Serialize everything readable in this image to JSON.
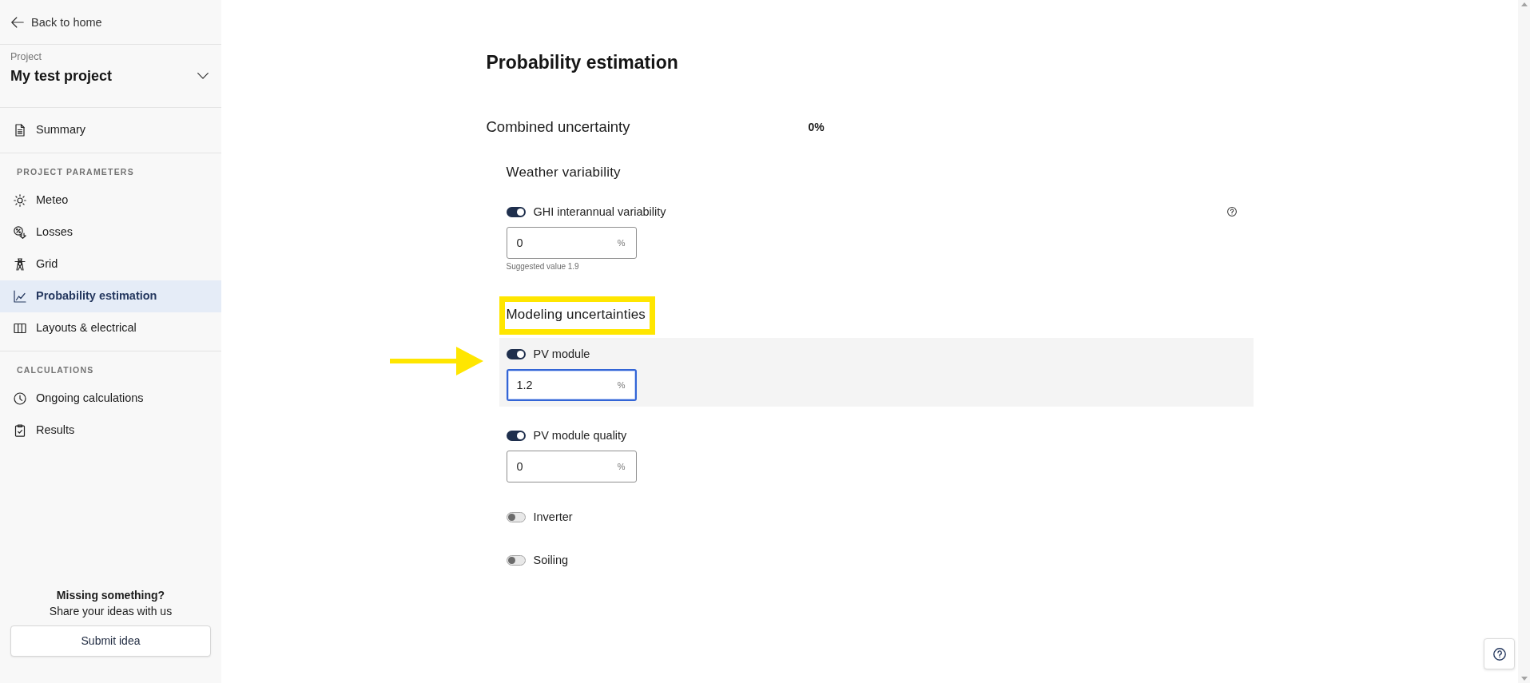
{
  "sidebar": {
    "back_link": "Back to home",
    "project": {
      "label": "Project",
      "name": "My test project"
    },
    "sections": [
      {
        "items": [
          {
            "label": "Summary",
            "selected": false
          }
        ]
      },
      {
        "heading": "PROJECT PARAMETERS",
        "items": [
          {
            "label": "Meteo",
            "selected": false
          },
          {
            "label": "Losses",
            "selected": false
          },
          {
            "label": "Grid",
            "selected": false
          },
          {
            "label": "Probability estimation",
            "selected": true
          },
          {
            "label": "Layouts & electrical",
            "selected": false
          }
        ]
      },
      {
        "heading": "CALCULATIONS",
        "items": [
          {
            "label": "Ongoing calculations",
            "selected": false
          },
          {
            "label": "Results",
            "selected": false
          }
        ]
      }
    ],
    "feedback": {
      "title": "Missing something?",
      "text": "Share your ideas with us",
      "button": "Submit idea"
    }
  },
  "main": {
    "title": "Probability estimation",
    "combined_uncertainty": {
      "label": "Combined uncertainty",
      "value": "0%"
    },
    "groups": [
      {
        "title": "Weather variability",
        "highlighted": false,
        "params": [
          {
            "label": "GHI interannual variability",
            "on": true,
            "value": "0",
            "unit": "%",
            "hint": "Suggested value 1.9",
            "help": true,
            "focused": false,
            "pointed": false
          }
        ]
      },
      {
        "title": "Modeling uncertainties",
        "highlighted": true,
        "params": [
          {
            "label": "PV module",
            "on": true,
            "value": "1.2",
            "unit": "%",
            "help": false,
            "focused": true,
            "pointed": true
          },
          {
            "label": "PV module quality",
            "on": true,
            "value": "0",
            "unit": "%",
            "help": false,
            "focused": false,
            "pointed": false
          },
          {
            "label": "Inverter",
            "on": false,
            "help": false,
            "focused": false,
            "pointed": false
          },
          {
            "label": "Soiling",
            "on": false,
            "help": false,
            "focused": false,
            "pointed": false
          }
        ]
      }
    ]
  }
}
